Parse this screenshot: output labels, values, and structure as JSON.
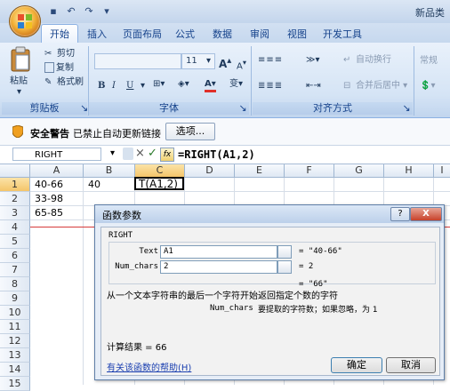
{
  "window": {
    "title": "新品类",
    "qat_icons": [
      "save-icon",
      "undo-icon",
      "redo-icon",
      "customize-icon"
    ]
  },
  "ribbon": {
    "tabs": [
      "开始",
      "插入",
      "页面布局",
      "公式",
      "数据",
      "审阅",
      "视图",
      "开发工具"
    ],
    "active_tab": "开始",
    "clipboard": {
      "paste_label": "粘贴",
      "cut_label": "剪切",
      "copy_label": "复制",
      "format_painter_label": "格式刷",
      "group_label": "剪贴板"
    },
    "font": {
      "font_size": "11",
      "group_label": "字体",
      "bold": "B",
      "italic": "I",
      "underline": "U",
      "grow": "A",
      "shrink": "A",
      "font_color": "A",
      "phonetic": "变"
    },
    "alignment": {
      "wrap_text_label": "自动换行",
      "merge_label": "合并后居中",
      "group_label": "对齐方式"
    },
    "number": {
      "format": "常规"
    }
  },
  "security_bar": {
    "title": "安全警告",
    "message": "已禁止自动更新链接",
    "options_button": "选项..."
  },
  "formula_bar": {
    "name_box": "RIGHT",
    "cancel": "×",
    "enter": "✓",
    "fx": "fx",
    "formula": "=RIGHT(A1,2)"
  },
  "sheet": {
    "columns": [
      "A",
      "B",
      "C",
      "D",
      "E",
      "F",
      "G",
      "H",
      "I"
    ],
    "selected_column": "C",
    "rows": [
      "1",
      "2",
      "3",
      "4",
      "5",
      "6",
      "7",
      "8",
      "9",
      "10",
      "11",
      "12",
      "13",
      "14",
      "15"
    ],
    "selected_row": "1",
    "cells": {
      "A1": "40-66",
      "B1": "40",
      "C1": "T(A1,2)",
      "A2": "33-98",
      "A3": "65-85"
    }
  },
  "dialog": {
    "title": "函数参数",
    "help_btn": "?",
    "close_btn": "X",
    "function_name": "RIGHT",
    "args": [
      {
        "label": "Text",
        "value": "A1",
        "result": "= \"40-66\""
      },
      {
        "label": "Num_chars",
        "value": "2",
        "result": "= 2"
      }
    ],
    "formula_result_preview": "= \"66\"",
    "description": "从一个文本字符串的最后一个字符开始返回指定个数的字符",
    "arg_help_name": "Num_chars",
    "arg_help_text": "要提取的字符数；如果忽略，为 1",
    "calc_result_label": "计算结果 = ",
    "calc_result_value": "66",
    "help_link": "有关该函数的帮助(H)",
    "ok_button": "确定",
    "cancel_button": "取消"
  },
  "colors": {
    "ribbon_text": "#15428b",
    "select_header": "#f4c56a",
    "annotation_line": "#d63b3b"
  }
}
